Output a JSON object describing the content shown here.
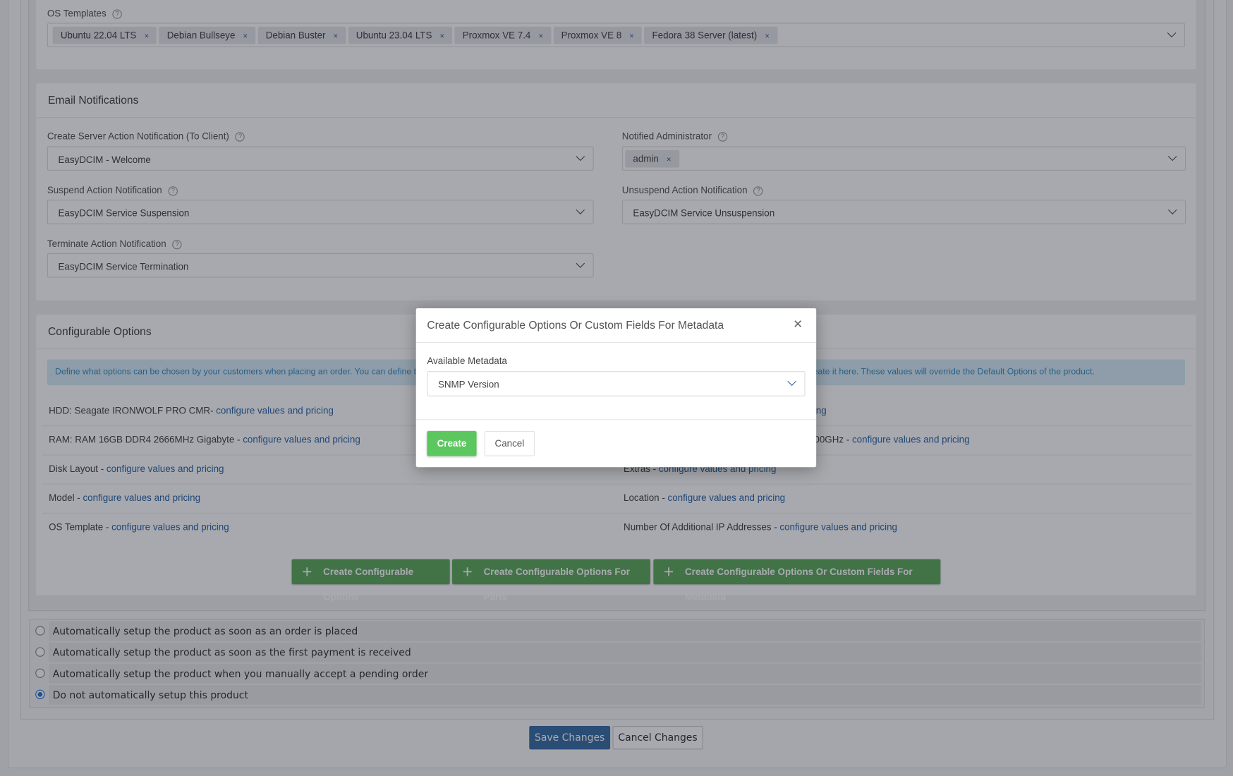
{
  "os_templates": {
    "label": "OS Templates",
    "tags": [
      "Ubuntu 22.04 LTS",
      "Debian Bullseye",
      "Debian Buster",
      "Ubuntu 23.04 LTS",
      "Proxmox VE 7.4",
      "Proxmox VE 8",
      "Fedora 38 Server (latest)"
    ],
    "remove_glyph": "×"
  },
  "email": {
    "title": "Email Notifications",
    "create_label": "Create Server Action Notification (To Client)",
    "create_value": "EasyDCIM - Welcome",
    "admin_label": "Notified Administrator",
    "admin_tag": "admin",
    "suspend_label": "Suspend Action Notification",
    "suspend_value": "EasyDCIM Service Suspension",
    "unsuspend_label": "Unsuspend Action Notification",
    "unsuspend_value": "EasyDCIM Service Unsuspension",
    "terminate_label": "Terminate Action Notification",
    "terminate_value": "EasyDCIM Service Termination"
  },
  "configurable": {
    "title": "Configurable Options",
    "info_left": "Define what options can be chosen by your customers when placing an order. You can define the",
    "info_right": "reate it here. These values will override the Default Options of the product.",
    "left_rows": [
      {
        "label": "HDD: Seagate IRONWOLF PRO CMR- ",
        "link": "configure values and pricing"
      },
      {
        "label": "RAM: RAM 16GB DDR4 2666MHz Gigabyte - ",
        "link": "configure values and pricing"
      },
      {
        "label": "Disk Layout - ",
        "link": "configure values and pricing"
      },
      {
        "label": "Model - ",
        "link": "configure values and pricing"
      },
      {
        "label": "OS Template - ",
        "link": "configure values and pricing"
      }
    ],
    "right_rows": [
      {
        "label": "",
        "link": "configure values and pricing"
      },
      {
        "label": ".00GHz - ",
        "link": "configure values and pricing"
      },
      {
        "label": "Extras - ",
        "link": "configure values and pricing"
      },
      {
        "label": "Location - ",
        "link": "configure values and pricing"
      },
      {
        "label": "Number Of Additional IP Addresses - ",
        "link": "configure values and pricing"
      }
    ],
    "buttons": [
      "Create Configurable Options",
      "Create Configurable Options For Parts",
      "Create Configurable Options Or Custom Fields For Metadata"
    ],
    "plus_glyph": "+"
  },
  "setup": {
    "options": [
      "Automatically setup the product as soon as an order is placed",
      "Automatically setup the product as soon as the first payment is received",
      "Automatically setup the product when you manually accept a pending order",
      "Do not automatically setup this product"
    ],
    "selected_index": 3
  },
  "footer": {
    "save": "Save Changes",
    "cancel": "Cancel Changes"
  },
  "modal": {
    "title": "Create Configurable Options Or Custom Fields For Metadata",
    "close_glyph": "✕",
    "field_label": "Available Metadata",
    "field_value": "SNMP Version",
    "create": "Create",
    "cancel": "Cancel"
  },
  "colors": {
    "green": "#5eab5e",
    "create_green": "#5cc75e",
    "save_blue": "#3a70a8",
    "link": "#2b66a8",
    "radio_selected": "#2a75d0"
  }
}
